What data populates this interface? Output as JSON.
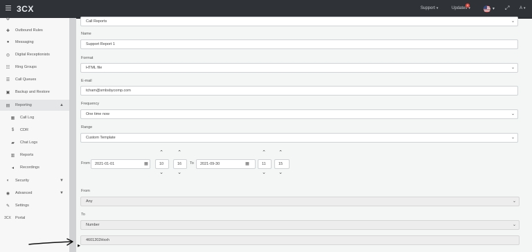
{
  "topbar": {
    "brand": "3CX",
    "support": "Support",
    "updates": "Updates",
    "updates_badge": "4",
    "user": "A",
    "caret": "▾"
  },
  "sidebar": {
    "items": [
      {
        "label": "Outbound Rules",
        "icon": "outbound-icon"
      },
      {
        "label": "Messaging",
        "icon": "message-icon"
      },
      {
        "label": "Digital Receptionists",
        "icon": "receptionist-icon"
      },
      {
        "label": "Ring Groups",
        "icon": "ring-groups-icon"
      },
      {
        "label": "Call Queues",
        "icon": "queue-icon"
      },
      {
        "label": "Backup and Restore",
        "icon": "backup-icon"
      },
      {
        "label": "Reporting",
        "icon": "reporting-icon"
      },
      {
        "label": "Call Log",
        "icon": "call-log-icon"
      },
      {
        "label": "CDR",
        "icon": "cdr-icon"
      },
      {
        "label": "Chat Logs",
        "icon": "chat-icon"
      },
      {
        "label": "Reports",
        "icon": "reports-icon"
      },
      {
        "label": "Recordings",
        "icon": "recordings-icon"
      },
      {
        "label": "Security",
        "icon": "security-icon"
      },
      {
        "label": "Advanced",
        "icon": "advanced-icon"
      },
      {
        "label": "Settings",
        "icon": "settings-icon"
      },
      {
        "label": "Portal",
        "icon": "portal-icon"
      }
    ],
    "portal_prefix": "3CX"
  },
  "form": {
    "top_select_value": "Call Reports",
    "name_label": "Name",
    "name_value": "Support Report 1",
    "format_label": "Format",
    "format_value": "HTML file",
    "email_label": "E-mail",
    "email_value": "tcham@smbsbycomp.com",
    "frequency_label": "Frequency",
    "frequency_value": "One time now",
    "range_label": "Range",
    "range_value": "Custom Template",
    "from_label": "From",
    "from_date": "2021-01-01",
    "from_hour": "10",
    "from_minute": "16",
    "to_label": "To",
    "to_date": "2021-09-30",
    "to_hour": "11",
    "to_minute": "15",
    "from2_label": "From",
    "from2_value": "Any",
    "to2_label": "To",
    "to2_value": "Number",
    "number_value": "4601202Hxxh"
  }
}
